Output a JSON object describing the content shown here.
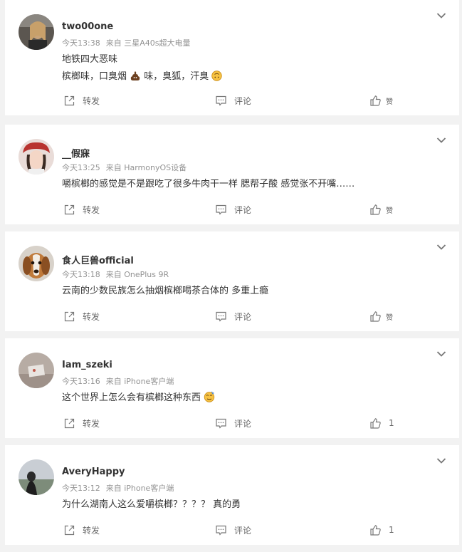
{
  "comments": [
    {
      "username": "two00one",
      "time": "今天13:38",
      "source": "来自 三星A40s超大电量",
      "lines": [
        "地铁四大恶味",
        "槟榔味，口臭烟",
        "味，臭狐，汗臭"
      ],
      "actions": {
        "share": "转发",
        "comment": "评论",
        "like": "赞"
      }
    },
    {
      "username": "__假寐",
      "time": "今天13:25",
      "source": "来自 HarmonyOS设备",
      "lines": [
        "嚼槟榔的感觉是不是跟吃了很多牛肉干一样 腮帮子酸 感觉张不开嘴……"
      ],
      "actions": {
        "share": "转发",
        "comment": "评论",
        "like": "赞"
      }
    },
    {
      "username": "食人巨兽official",
      "time": "今天13:18",
      "source": "来自 OnePlus 9R",
      "lines": [
        "云南的少数民族怎么抽烟槟榔喝茶合体的 多重上瘾"
      ],
      "actions": {
        "share": "转发",
        "comment": "评论",
        "like": "赞"
      }
    },
    {
      "username": "Iam_szeki",
      "time": "今天13:16",
      "source": "来自 iPhone客户端",
      "lines": [
        "这个世界上怎么会有槟榔这种东西"
      ],
      "actions": {
        "share": "转发",
        "comment": "评论",
        "like_count": "1"
      }
    },
    {
      "username": "AveryHappy",
      "time": "今天13:12",
      "source": "来自 iPhone客户端",
      "lines": [
        "为什么湖南人这么爱嚼槟榔？？？？ 真的勇"
      ],
      "actions": {
        "share": "转发",
        "comment": "评论",
        "like_count": "1"
      }
    }
  ]
}
